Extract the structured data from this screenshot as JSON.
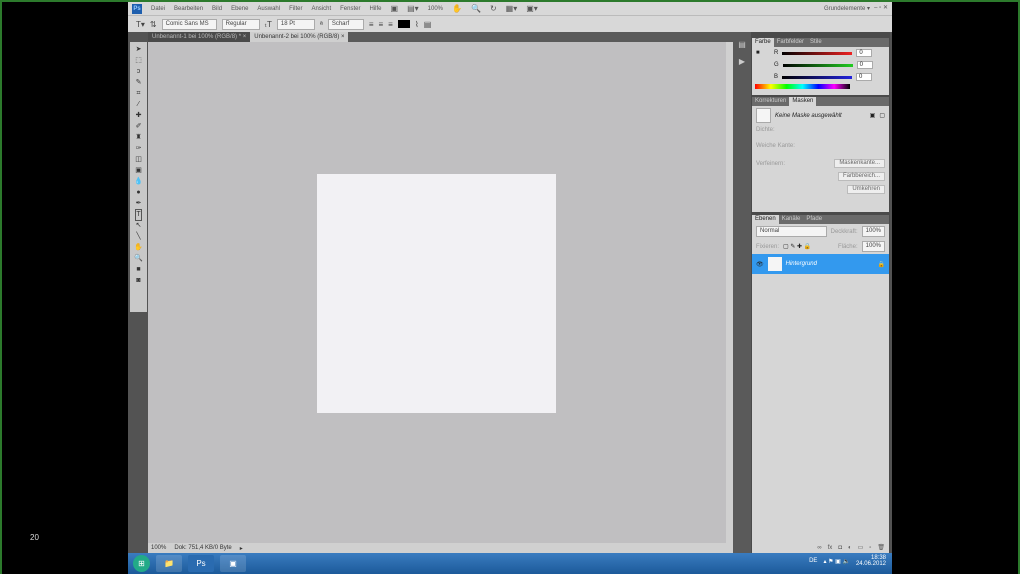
{
  "slide_number": "20",
  "menu": [
    "Datei",
    "Bearbeiten",
    "Bild",
    "Ebene",
    "Auswahl",
    "Filter",
    "Ansicht",
    "Fenster",
    "Hilfe"
  ],
  "zoom_menu": "100%",
  "workspace": "Grundelemente",
  "options": {
    "font": "Comic Sans MS",
    "style": "Regular",
    "size": "18 Pt",
    "antialias": "Scharf"
  },
  "tabs": [
    "Unbenannt-1 bei 100% (RGB/8) *",
    "Unbenannt-2 bei 100% (RGB/8)"
  ],
  "status": {
    "zoom": "100%",
    "doc": "Dok: 751,4 KB/0 Byte"
  },
  "color_panel": {
    "tabs": [
      "Farbe",
      "Farbfelder",
      "Stile"
    ],
    "r": "0",
    "g": "0",
    "b": "0",
    "r_label": "R",
    "g_label": "G",
    "b_label": "B"
  },
  "mask_panel": {
    "tabs": [
      "Korrekturen",
      "Masken"
    ],
    "no_mask": "Keine Maske ausgewählt",
    "density": "Dichte:",
    "feather": "Weiche Kante:",
    "refine": "Verfeinern:",
    "btn_edge": "Maskenkante...",
    "btn_color": "Farbbereich...",
    "btn_invert": "Umkehren"
  },
  "layers_panel": {
    "tabs": [
      "Ebenen",
      "Kanäle",
      "Pfade"
    ],
    "blend": "Normal",
    "opacity_label": "Deckkraft:",
    "opacity": "100%",
    "lock_label": "Fixieren:",
    "fill_label": "Fläche:",
    "fill": "100%",
    "layer": "Hintergrund"
  },
  "tray": {
    "lang": "DE",
    "time": "18:38",
    "date": "24.06.2012"
  },
  "colors": {
    "accent": "#3399ee",
    "frame": "#2c7a2c"
  }
}
